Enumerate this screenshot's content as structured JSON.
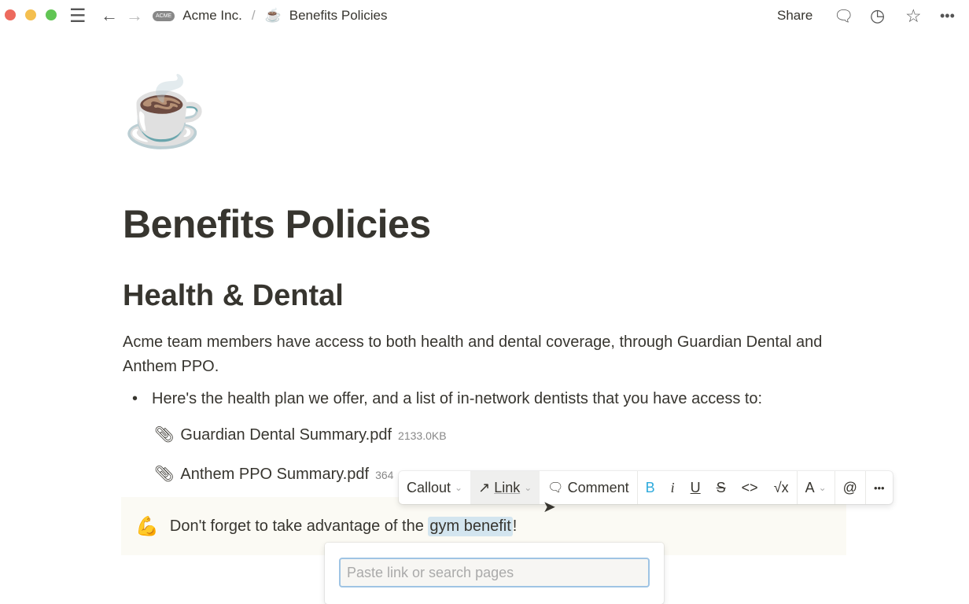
{
  "window": {
    "colors": {
      "close": "#ed6a5e",
      "minimize": "#f4bf4f",
      "maximize": "#61c554"
    }
  },
  "breadcrumb": {
    "workspace": "Acme Inc.",
    "workspace_logo": "ACME",
    "separator": "/",
    "page_icon": "☕",
    "page": "Benefits Policies"
  },
  "header": {
    "share": "Share"
  },
  "page": {
    "icon": "☕",
    "title": "Benefits Policies",
    "heading": "Health & Dental",
    "paragraph": "Acme team members have access to both health and dental coverage, through Guardian Dental and Anthem PPO.",
    "bullet": "Here's the health plan we offer, and a list of in-network dentists that you have access to:",
    "files": [
      {
        "name": "Guardian Dental Summary.pdf",
        "size": "2133.0KB"
      },
      {
        "name": "Anthem PPO Summary.pdf",
        "size": "364"
      }
    ],
    "callout": {
      "icon": "💪",
      "text_before": "Don't forget to take advantage of the ",
      "highlight": "gym benefit",
      "text_after": "!"
    }
  },
  "toolbar": {
    "block_type": "Callout",
    "link": "Link",
    "comment": "Comment",
    "bold": "B",
    "italic": "i",
    "underline": "U",
    "strike": "S",
    "code": "<>",
    "math": "√x",
    "color": "A",
    "mention": "@",
    "more": "•••",
    "bold_color": "#2eaadc"
  },
  "link_popup": {
    "placeholder": "Paste link or search pages",
    "value": ""
  }
}
